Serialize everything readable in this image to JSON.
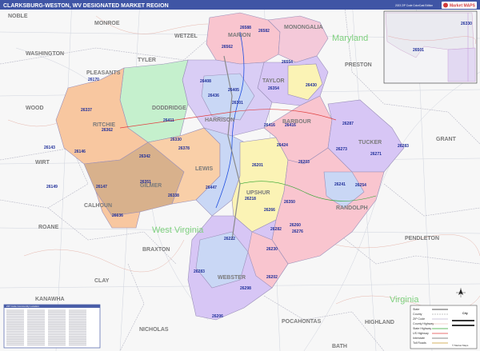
{
  "header": {
    "title": "CLARKSBURG-WESTON, WV DESIGNATED MARKET REGION",
    "edition": "2023 ZIP Code ColorCast Edition",
    "logo_text": "Market MAPS"
  },
  "states": [
    "Maryland",
    "West Virginia",
    "Virginia"
  ],
  "counties": [
    "NOBLE",
    "MONROE",
    "WETZEL",
    "MARION",
    "MONONGALIA",
    "WASHINGTON",
    "TYLER",
    "PLEASANTS",
    "TAYLOR",
    "PRESTON",
    "WOOD",
    "DODDRIDGE",
    "HARRISON",
    "RITCHIE",
    "BARBOUR",
    "TUCKER",
    "GRANT",
    "WIRT",
    "LEWIS",
    "UPSHUR",
    "RANDOLPH",
    "CALHOUN",
    "GILMER",
    "ROANE",
    "BRAXTON",
    "PENDLETON",
    "CLAY",
    "WEBSTER",
    "KANAWHA",
    "POCAHONTAS",
    "HIGHLAND",
    "NICHOLAS",
    "BATH"
  ],
  "zips": [
    "26562",
    "26588",
    "26554",
    "26582",
    "26430",
    "26354",
    "26170",
    "26408",
    "26405",
    "26301",
    "26416",
    "26337",
    "26436",
    "26411",
    "26330",
    "26416",
    "26362",
    "26271",
    "26143",
    "26146",
    "26378",
    "26342",
    "26424",
    "26201",
    "26283",
    "26147",
    "26447",
    "26218",
    "26254",
    "26351",
    "26203",
    "26260",
    "26206",
    "26222",
    "26298",
    "26230",
    "26283",
    "26202",
    "26636",
    "26149",
    "26350",
    "26266",
    "26338",
    "26241",
    "26273",
    "26276",
    "26282",
    "26287"
  ],
  "inset": {
    "zips": [
      "26330",
      "26501"
    ]
  },
  "index_panel": {
    "title": "ZIP Code Community Location"
  },
  "legend": {
    "items": [
      "State",
      "County",
      "ZIP Code",
      "County Highway",
      "State Highway",
      "US Highway",
      "Interstate",
      "Toll Roads"
    ],
    "scale_title": "City",
    "copyright": "© Market Maps"
  },
  "colors": {
    "header_bg": "#3f55a5",
    "pink": "#f9c5cf",
    "lavender": "#d7c6f5",
    "blue": "#c9d7f5",
    "yellow": "#fbf3b5",
    "peach": "#f8c7a0",
    "green": "#c5f0cd",
    "brown": "#d8b18c"
  }
}
